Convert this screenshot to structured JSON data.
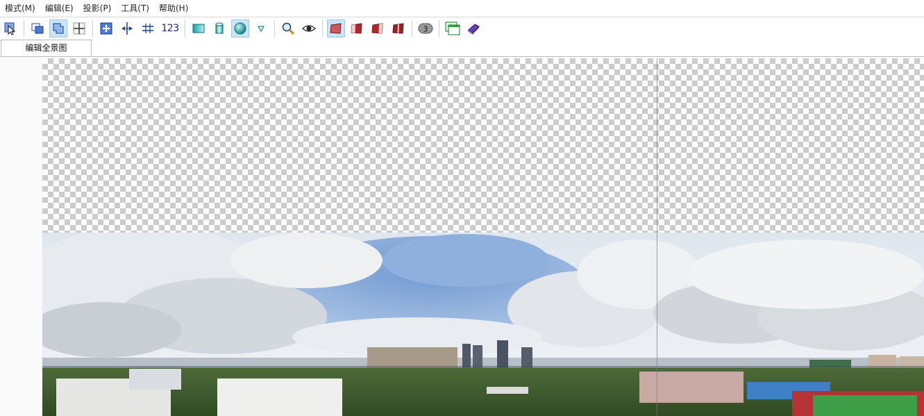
{
  "menu": [
    {
      "label": "模式(M)"
    },
    {
      "label": "编辑(E)"
    },
    {
      "label": "投影(P)"
    },
    {
      "label": "工具(T)"
    },
    {
      "label": "帮助(H)"
    }
  ],
  "toolbar": {
    "items": [
      {
        "icon": "select-arrow-icon",
        "active": false
      },
      {
        "icon": "control-points-icon",
        "active": false
      },
      {
        "icon": "crop-icon",
        "active": true
      },
      {
        "icon": "crosshair-icon",
        "active": false
      },
      {
        "icon": "move-drag-icon",
        "active": false
      },
      {
        "icon": "center-horizontal-icon",
        "active": false
      },
      {
        "icon": "straighten-icon",
        "active": false
      },
      {
        "icon": "numeric-transform-icon",
        "active": false
      },
      {
        "icon": "rectilinear-projection-icon",
        "active": false
      },
      {
        "icon": "cylindrical-projection-icon",
        "active": false
      },
      {
        "icon": "spherical-projection-icon",
        "active": true
      },
      {
        "icon": "projection-dropdown-icon",
        "active": false
      },
      {
        "icon": "zoom-icon",
        "active": false
      },
      {
        "icon": "preview-eye-icon",
        "active": false
      },
      {
        "icon": "blend-normal-icon",
        "active": true
      },
      {
        "icon": "blend-left-icon",
        "active": false
      },
      {
        "icon": "blend-right-icon",
        "active": false
      },
      {
        "icon": "blend-split-icon",
        "active": false
      },
      {
        "icon": "image-count-badge-icon",
        "active": false
      },
      {
        "icon": "window-layout-icon",
        "active": false
      },
      {
        "icon": "help-book-icon",
        "active": false
      }
    ],
    "numeric_label": "123",
    "badge_count": "3"
  },
  "tabs": [
    {
      "label": "编辑全景图",
      "active": true
    }
  ],
  "colors": {
    "accent_active": "#cce4f7",
    "checker_light": "#ffffff",
    "checker_dark": "#cccccc"
  }
}
